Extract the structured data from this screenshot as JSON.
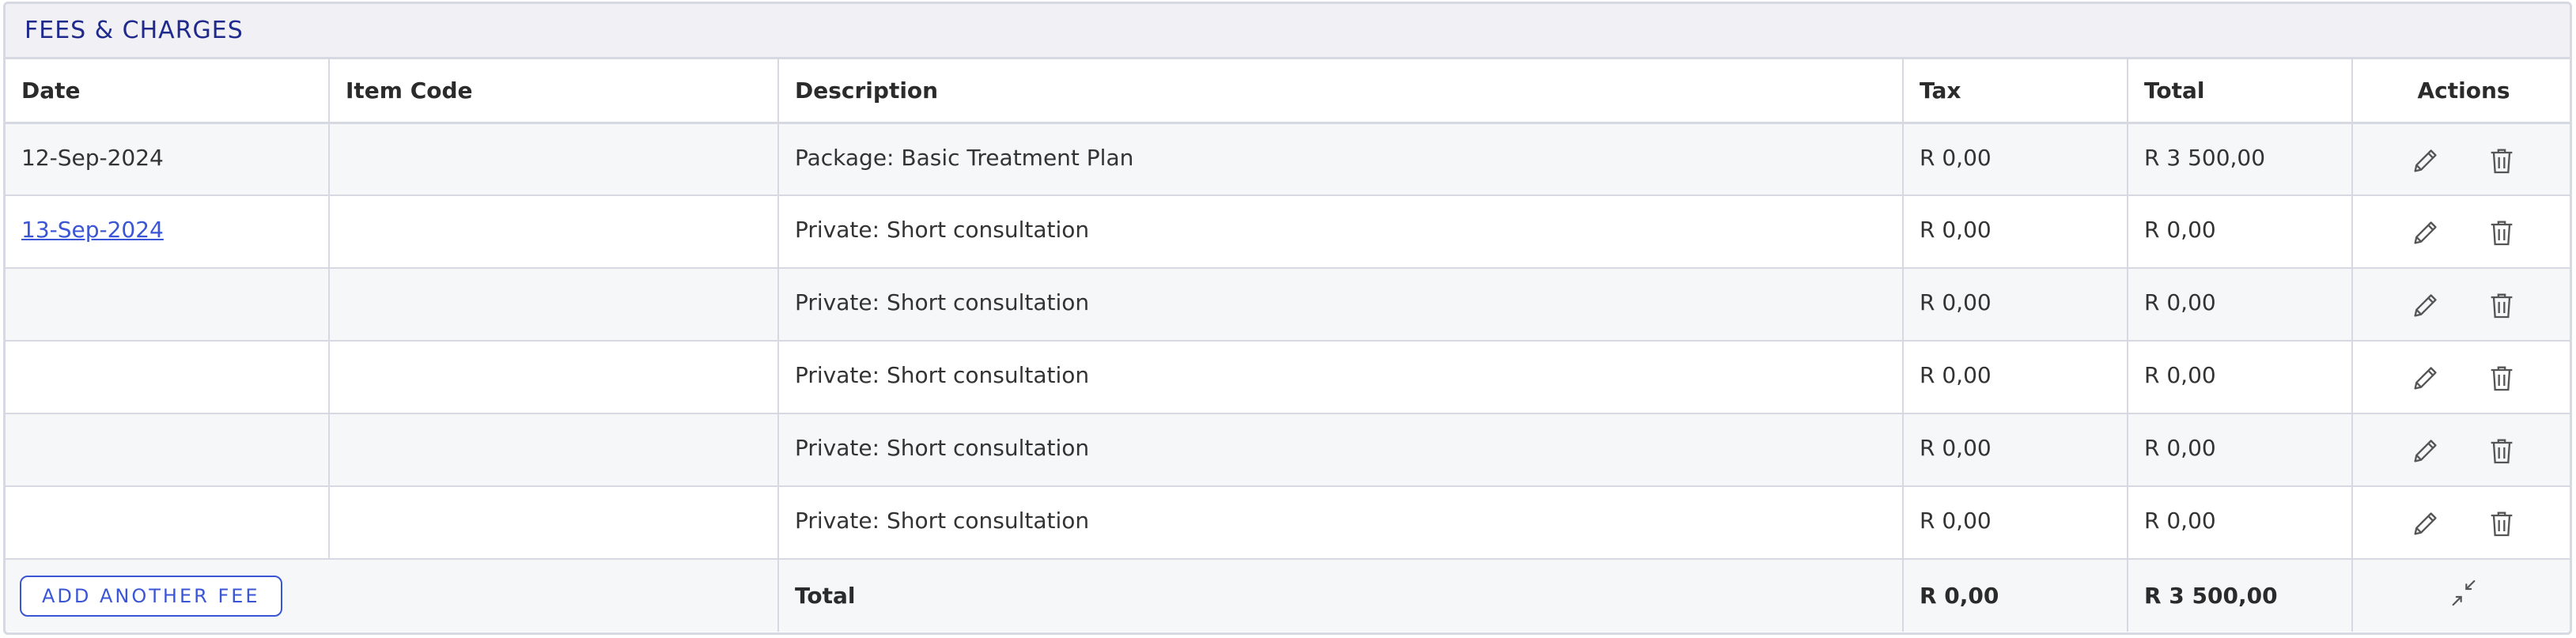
{
  "panel": {
    "title": "FEES & CHARGES"
  },
  "table": {
    "headers": {
      "date": "Date",
      "item_code": "Item Code",
      "description": "Description",
      "tax": "Tax",
      "total": "Total",
      "actions": "Actions"
    },
    "rows": [
      {
        "date": "12-Sep-2024",
        "item_code": "",
        "description": "Package: Basic Treatment Plan",
        "tax": "R 0,00",
        "total": "R 3 500,00"
      },
      {
        "date": "13-Sep-2024",
        "item_code": "",
        "description": "Private: Short consultation",
        "tax": "R 0,00",
        "total": "R 0,00"
      },
      {
        "date": "",
        "item_code": "",
        "description": "Private: Short consultation",
        "tax": "R 0,00",
        "total": "R 0,00"
      },
      {
        "date": "",
        "item_code": "",
        "description": "Private: Short consultation",
        "tax": "R 0,00",
        "total": "R 0,00"
      },
      {
        "date": "",
        "item_code": "",
        "description": "Private: Short consultation",
        "tax": "R 0,00",
        "total": "R 0,00"
      },
      {
        "date": "",
        "item_code": "",
        "description": "Private: Short consultation",
        "tax": "R 0,00",
        "total": "R 0,00"
      }
    ],
    "icons": {
      "edit": "pencil-icon",
      "delete": "trash-icon",
      "collapse": "collapse-arrows-icon"
    }
  },
  "footer": {
    "add_button_label": "ADD ANOTHER FEE",
    "total_label": "Total",
    "tax_total": "R 0,00",
    "grand_total": "R 3 500,00"
  },
  "colors": {
    "title": "#1f2a8c",
    "link": "#3a55d6",
    "border": "#d6d8e2",
    "header_bg": "#f0f0f5",
    "alt_row_bg": "#f6f7f9"
  }
}
